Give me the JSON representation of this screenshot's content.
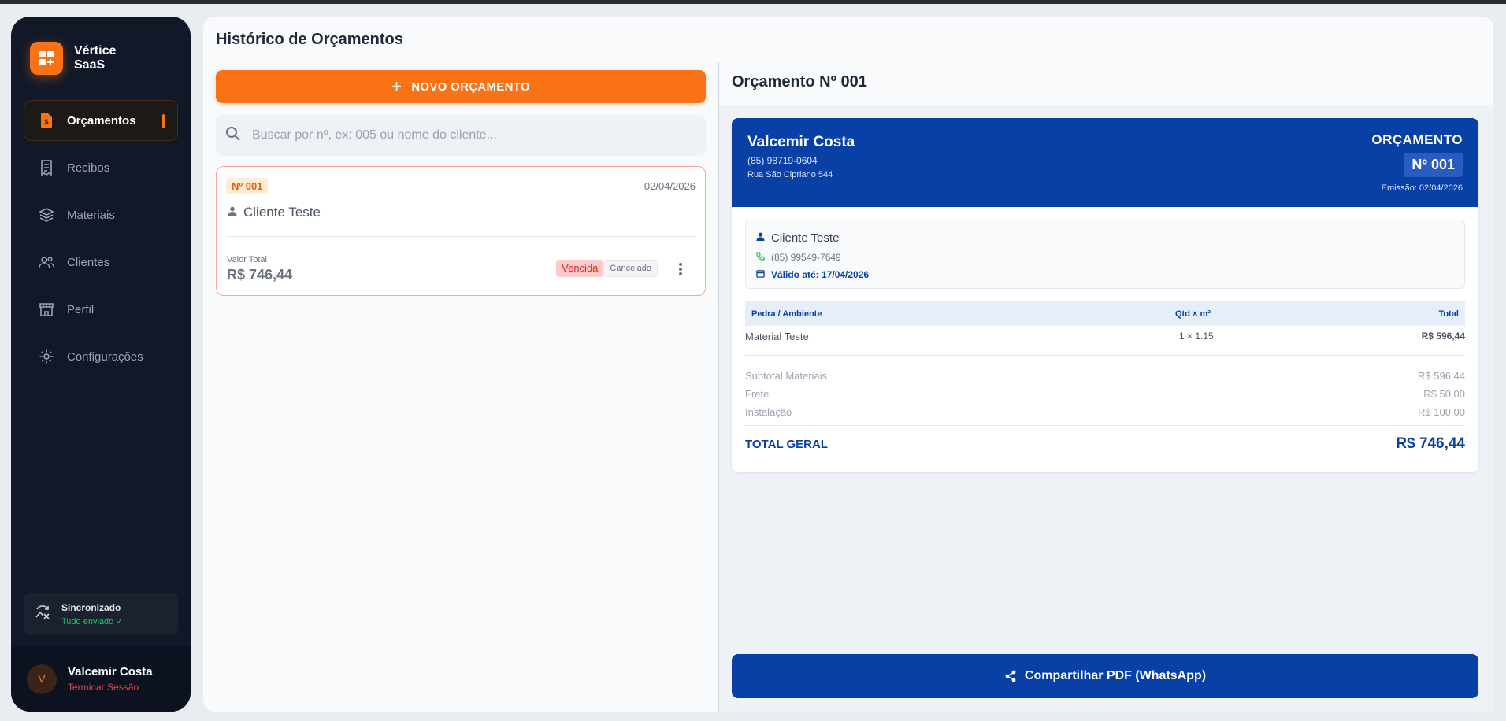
{
  "brand": {
    "line1": "Vértice",
    "line2": "SaaS",
    "accent": "#f97316"
  },
  "sidebar": {
    "items": [
      {
        "label": "Orçamentos",
        "icon": "document-dollar-icon",
        "active": true
      },
      {
        "label": "Recibos",
        "icon": "receipt-icon",
        "active": false
      },
      {
        "label": "Materiais",
        "icon": "layers-icon",
        "active": false
      },
      {
        "label": "Clientes",
        "icon": "users-icon",
        "active": false
      },
      {
        "label": "Perfil",
        "icon": "store-icon",
        "active": false
      },
      {
        "label": "Configurações",
        "icon": "gear-icon",
        "active": false
      }
    ],
    "sync": {
      "title": "Sincronizado",
      "status": "Tudo enviado ✓"
    },
    "user": {
      "initial": "V",
      "name": "Valcemir Costa",
      "logout": "Terminar Sessão"
    }
  },
  "main": {
    "title": "Histórico de Orçamentos",
    "new_button": "NOVO ORÇAMENTO",
    "search_placeholder": "Buscar por nº, ex: 005 ou nome do cliente...",
    "quote_card": {
      "number": "Nº 001",
      "date": "02/04/2026",
      "client": "Cliente Teste",
      "total_label": "Valor Total",
      "total_value": "R$ 746,44",
      "badge_status": "Vencida",
      "badge_state": "Cancelado"
    }
  },
  "detail": {
    "title": "Orçamento Nº 001",
    "header": {
      "company": "Valcemir Costa",
      "phone": "(85) 98719-0604",
      "address": "Rua São Cipriano 544",
      "kind": "ORÇAMENTO",
      "number": "Nº 001",
      "emission": "Emissão: 02/04/2026"
    },
    "client": {
      "name": "Cliente Teste",
      "phone": "(85) 99549-7649",
      "valid_until": "Válido até: 17/04/2026"
    },
    "table": {
      "headers": [
        "Pedra / Ambiente",
        "Qtd × m²",
        "Total"
      ],
      "rows": [
        {
          "material": "Material Teste",
          "qty": "1 × 1.15",
          "total": "R$ 596,44"
        }
      ]
    },
    "summary": [
      {
        "label": "Subtotal Materiais",
        "value": "R$ 596,44"
      },
      {
        "label": "Frete",
        "value": "R$ 50,00"
      },
      {
        "label": "Instalação",
        "value": "R$ 100,00"
      }
    ],
    "grand_total": {
      "label": "TOTAL GERAL",
      "value": "R$ 746,44"
    },
    "share_button": "Compartilhar PDF (WhatsApp)",
    "primary_color": "#0940a6"
  }
}
